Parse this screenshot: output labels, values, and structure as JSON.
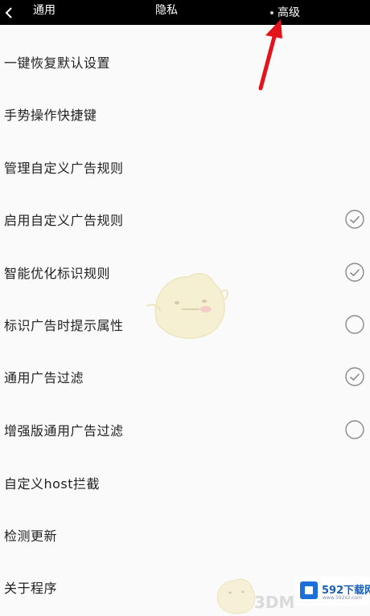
{
  "header": {
    "back_icon": "chevron-left-icon",
    "tabs": [
      {
        "label": "通用"
      },
      {
        "label": "隐私"
      },
      {
        "label": "高级",
        "active": true
      }
    ]
  },
  "settings": {
    "items": [
      {
        "label": "一键恢复默认设置"
      },
      {
        "label": "手势操作快捷键"
      },
      {
        "label": "管理自定义广告规则"
      },
      {
        "label": "启用自定义广告规则",
        "checked": true
      },
      {
        "label": "智能优化标识规则",
        "checked": true
      },
      {
        "label": "标识广告时提示属性",
        "checked": false
      },
      {
        "label": "通用广告过滤",
        "checked": true
      },
      {
        "label": "增强版通用广告过滤",
        "checked": false
      },
      {
        "label": "自定义host拦截"
      },
      {
        "label": "检测更新"
      },
      {
        "label": "关于程序"
      }
    ]
  },
  "annotation": {
    "arrow_color": "#e3131c"
  },
  "watermark": {
    "site_text": "592下载网",
    "site_url": "www.592xz.com",
    "brand": "3DM"
  }
}
